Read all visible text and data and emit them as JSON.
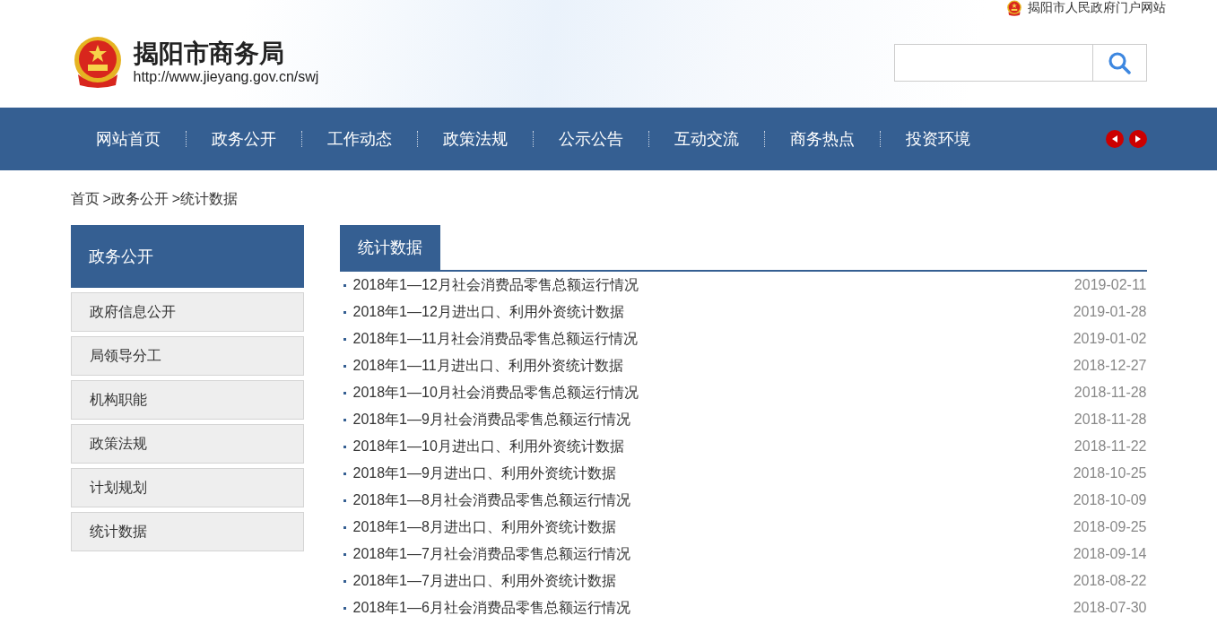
{
  "top_link": "揭阳市人民政府门户网站",
  "header": {
    "title": "揭阳市商务局",
    "url": "http://www.jieyang.gov.cn/swj"
  },
  "nav": [
    "网站首页",
    "政务公开",
    "工作动态",
    "政策法规",
    "公示公告",
    "互动交流",
    "商务热点",
    "投资环境"
  ],
  "breadcrumb": [
    "首页",
    ">政务公开",
    ">统计数据"
  ],
  "sidebar": {
    "title": "政务公开",
    "items": [
      "政府信息公开",
      "局领导分工",
      "机构职能",
      "政策法规",
      "计划规划",
      "统计数据"
    ]
  },
  "main": {
    "tab": "统计数据",
    "articles": [
      {
        "title": "2018年1—12月社会消费品零售总额运行情况",
        "date": "2019-02-11"
      },
      {
        "title": "2018年1—12月进出口、利用外资统计数据",
        "date": "2019-01-28"
      },
      {
        "title": "2018年1—11月社会消费品零售总额运行情况",
        "date": "2019-01-02"
      },
      {
        "title": "2018年1—11月进出口、利用外资统计数据",
        "date": "2018-12-27"
      },
      {
        "title": "2018年1—10月社会消费品零售总额运行情况",
        "date": "2018-11-28"
      },
      {
        "title": "2018年1—9月社会消费品零售总额运行情况",
        "date": "2018-11-28"
      },
      {
        "title": "2018年1—10月进出口、利用外资统计数据",
        "date": "2018-11-22"
      },
      {
        "title": "2018年1—9月进出口、利用外资统计数据",
        "date": "2018-10-25"
      },
      {
        "title": "2018年1—8月社会消费品零售总额运行情况",
        "date": "2018-10-09"
      },
      {
        "title": "2018年1—8月进出口、利用外资统计数据",
        "date": "2018-09-25"
      },
      {
        "title": "2018年1—7月社会消费品零售总额运行情况",
        "date": "2018-09-14"
      },
      {
        "title": "2018年1—7月进出口、利用外资统计数据",
        "date": "2018-08-22"
      },
      {
        "title": "2018年1—6月社会消费品零售总额运行情况",
        "date": "2018-07-30"
      }
    ]
  }
}
